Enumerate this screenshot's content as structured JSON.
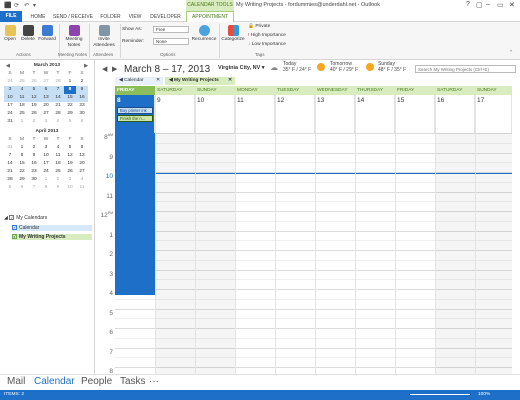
{
  "window": {
    "title": "My Writing Projects - fordummies@underdahl.net - Outlook",
    "contextual_tab": "CALENDAR TOOLS",
    "controls": [
      "?",
      "▢",
      "–",
      "▭",
      "✕"
    ]
  },
  "tabs": [
    "FILE",
    "HOME",
    "SEND / RECEIVE",
    "FOLDER",
    "VIEW",
    "DEVELOPER",
    "APPOINTMENT"
  ],
  "ribbon": {
    "open": "Open",
    "delete": "Delete",
    "forward": "Forward",
    "meeting_notes": "Meeting Notes",
    "invite": "Invite Attendees",
    "show_as_label": "Show As:",
    "show_as_value": "Free",
    "reminder_label": "Reminder:",
    "reminder_value": "None",
    "recurrence": "Recurrence",
    "categorize": "Categorize",
    "private": "Private",
    "high": "High Importance",
    "low": "Low Importance",
    "groups": [
      "Actions",
      "Meeting Notes",
      "Attendees",
      "Options",
      "Tags"
    ]
  },
  "minical": [
    {
      "title": "March 2013",
      "days": [
        "S",
        "M",
        "T",
        "W",
        "T",
        "F",
        "S"
      ],
      "weeks": [
        [
          "24",
          "25",
          "26",
          "27",
          "28",
          "1",
          "2"
        ],
        [
          "3",
          "4",
          "5",
          "6",
          "7",
          "8",
          "9"
        ],
        [
          "10",
          "11",
          "12",
          "13",
          "14",
          "15",
          "16"
        ],
        [
          "17",
          "18",
          "19",
          "20",
          "21",
          "22",
          "23"
        ],
        [
          "24",
          "25",
          "26",
          "27",
          "28",
          "29",
          "30"
        ],
        [
          "31",
          "1",
          "2",
          "3",
          "4",
          "5",
          "6"
        ]
      ]
    },
    {
      "title": "April 2013",
      "days": [
        "S",
        "M",
        "T",
        "W",
        "T",
        "F",
        "S"
      ],
      "weeks": [
        [
          "31",
          "1",
          "2",
          "3",
          "4",
          "5",
          "6"
        ],
        [
          "7",
          "8",
          "9",
          "10",
          "11",
          "12",
          "13"
        ],
        [
          "14",
          "15",
          "16",
          "17",
          "18",
          "19",
          "20"
        ],
        [
          "21",
          "22",
          "23",
          "24",
          "25",
          "26",
          "27"
        ],
        [
          "28",
          "29",
          "30",
          "1",
          "2",
          "3",
          "4"
        ],
        [
          "5",
          "6",
          "7",
          "8",
          "9",
          "10",
          "11"
        ]
      ]
    }
  ],
  "folders": {
    "group": "My Calendars",
    "items": [
      "Calendar",
      "My Writing Projects"
    ]
  },
  "header": {
    "range": "March 8 – 17, 2013",
    "location": "Virginia City, NV",
    "weather": [
      {
        "day": "Today",
        "temp": "35° F / 24° F"
      },
      {
        "day": "Tomorrow",
        "temp": "40° F / 29° F"
      },
      {
        "day": "Sunday",
        "temp": "48° F / 35° F"
      }
    ],
    "search_placeholder": "Search My Writing Projects (Ctrl+E)"
  },
  "calendar_tabs": [
    "Calendar",
    "My Writing Projects"
  ],
  "days": [
    {
      "name": "FRIDAY",
      "num": "8"
    },
    {
      "name": "SATURDAY",
      "num": "9"
    },
    {
      "name": "SUNDAY",
      "num": "10"
    },
    {
      "name": "MONDAY",
      "num": "11"
    },
    {
      "name": "TUESDAY",
      "num": "12"
    },
    {
      "name": "WEDNESDAY",
      "num": "13"
    },
    {
      "name": "THURSDAY",
      "num": "14"
    },
    {
      "name": "FRIDAY",
      "num": "15"
    },
    {
      "name": "SATURDAY",
      "num": "16"
    },
    {
      "name": "SUNDAY",
      "num": "17"
    }
  ],
  "events": [
    "Buy printer ink",
    "Finish the n..."
  ],
  "hours": [
    {
      "h": "8",
      "s": "AM"
    },
    {
      "h": "9",
      "s": ""
    },
    {
      "h": "10",
      "s": ""
    },
    {
      "h": "11",
      "s": ""
    },
    {
      "h": "12",
      "s": "PM"
    },
    {
      "h": "1",
      "s": ""
    },
    {
      "h": "2",
      "s": ""
    },
    {
      "h": "3",
      "s": ""
    },
    {
      "h": "4",
      "s": ""
    },
    {
      "h": "5",
      "s": ""
    },
    {
      "h": "6",
      "s": ""
    },
    {
      "h": "7",
      "s": ""
    },
    {
      "h": "8",
      "s": ""
    }
  ],
  "nav": [
    "Mail",
    "Calendar",
    "People",
    "Tasks",
    "···"
  ],
  "status": {
    "items": "ITEMS: 2",
    "zoom": "100%"
  },
  "colors": {
    "accent": "#1e6fc7",
    "green": "#d8ecbf"
  }
}
